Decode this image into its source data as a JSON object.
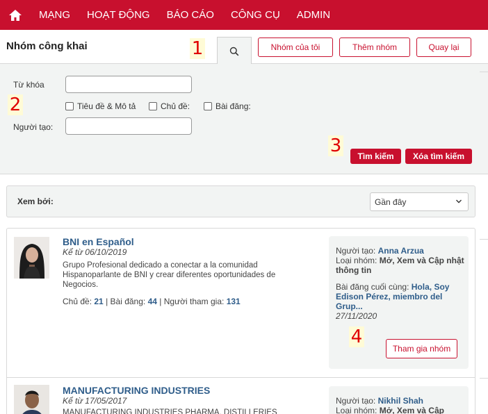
{
  "nav": {
    "items": [
      "MẠNG",
      "HOẠT ĐỘNG",
      "BÁO CÁO",
      "CÔNG CỤ",
      "ADMIN"
    ]
  },
  "header": {
    "title": "Nhóm công khai",
    "my_groups": "Nhóm của tôi",
    "add_group": "Thêm nhóm",
    "back": "Quay lại"
  },
  "search": {
    "keyword_label": "Từ khóa",
    "keyword_value": "",
    "creator_label": "Người tạo:",
    "creator_value": "",
    "options": [
      "Tiêu đề & Mô tả",
      "Chủ đề:",
      "Bài đăng:"
    ],
    "search_btn": "Tìm kiếm",
    "clear_btn": "Xóa tìm kiếm"
  },
  "sort": {
    "label": "Xem bởi:",
    "selected": "Gần đây"
  },
  "groups": [
    {
      "name": "BNI en Español",
      "since": "Kể từ 06/10/2019",
      "description": "Grupo Profesional dedicado a conectar a la comunidad Hispanoparlante de BNI y crear diferentes oportunidades de Negocios.",
      "stats": {
        "topics_label": "Chủ đề:",
        "topics": "21",
        "posts_label": "Bài đăng:",
        "posts": "44",
        "members_label": "Người tham gia:",
        "members": "131"
      },
      "creator_label": "Người tạo:",
      "creator": "Anna Arzua",
      "type_label": "Loại nhóm:",
      "type": "Mở, Xem và Cập nhật thông tin",
      "last_post_label": "Bài đăng cuối cùng:",
      "last_post": "Hola, Soy Edison Pérez, miembro del Grup...",
      "last_post_date": "27/11/2020",
      "join": "Tham gia nhóm"
    },
    {
      "name": "MANUFACTURING INDUSTRIES",
      "since": "Kể từ 17/05/2017",
      "description": "MANUFACTURING INDUSTRIES PHARMA, DISTILLERIES",
      "creator_label": "Người tạo:",
      "creator": "Nikhil Shah",
      "type_label": "Loại nhóm:",
      "type": "Mở, Xem và Cập"
    }
  ],
  "annotations": [
    "1",
    "2",
    "3",
    "4"
  ],
  "colors": {
    "brand": "#c8102e",
    "link": "#2f5d8a",
    "panel": "#f2f4f3"
  }
}
